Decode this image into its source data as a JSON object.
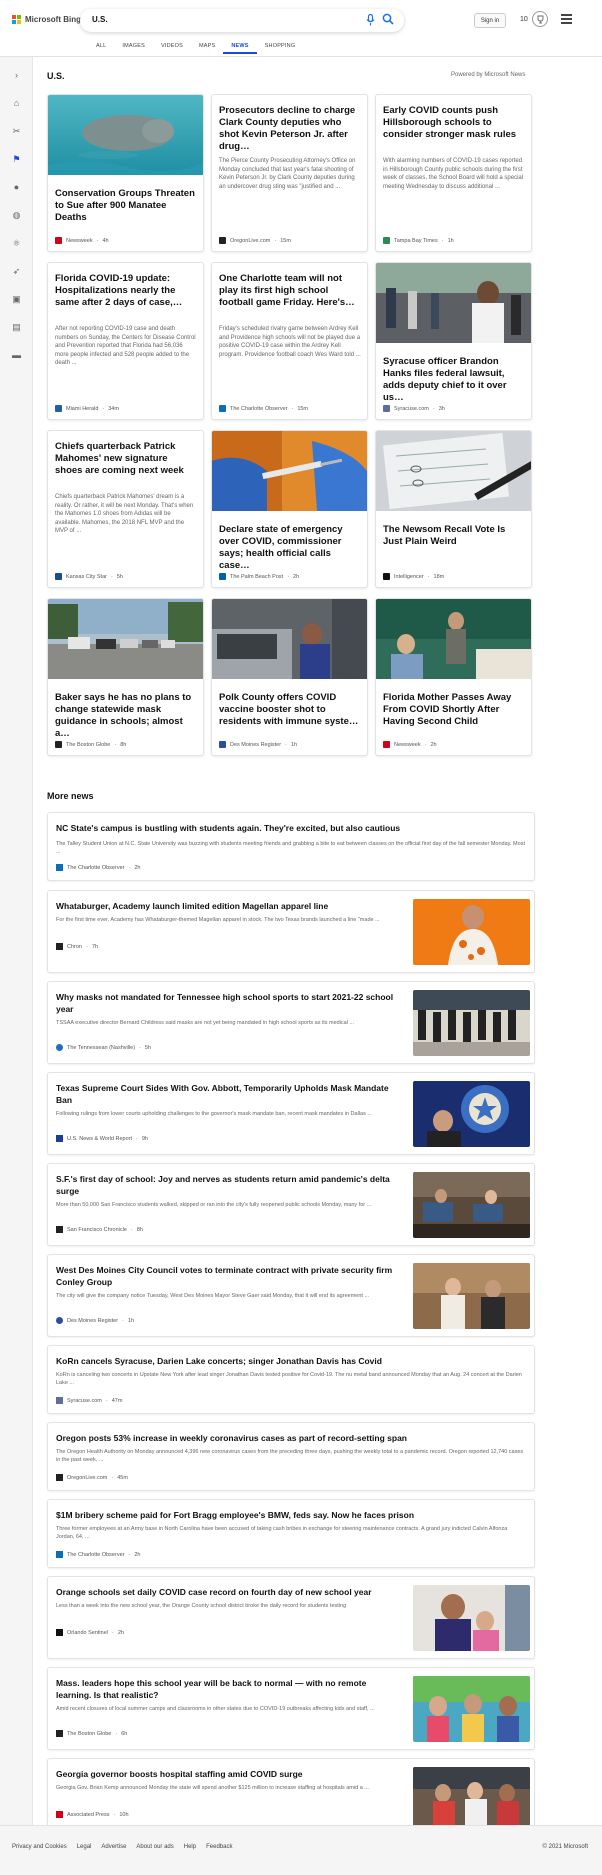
{
  "brand": {
    "name": "Microsoft Bing",
    "colors": [
      "#f25022",
      "#7fba00",
      "#00a4ef",
      "#ffb900"
    ]
  },
  "search": {
    "query": "U.S."
  },
  "header": {
    "sign_in": "Sign in",
    "rewards_points": "10"
  },
  "tabs": [
    {
      "label": "ALL"
    },
    {
      "label": "IMAGES"
    },
    {
      "label": "VIDEOS"
    },
    {
      "label": "MAPS"
    },
    {
      "label": "NEWS"
    },
    {
      "label": "SHOPPING"
    }
  ],
  "section": {
    "title": "U.S.",
    "powered_by": "Powered by Microsoft News"
  },
  "cards": [
    {
      "title": "Conservation Groups Threaten to Sue after 900 Manatee Deaths",
      "snippet": "",
      "source": "Newsweek",
      "age": "4h",
      "favicon": "#d0021b"
    },
    {
      "title": "Prosecutors decline to charge Clark County deputies who shot Kevin Peterson Jr. after drug…",
      "snippet": "The Pierce County Prosecuting Attorney's Office on Monday concluded that last year's fatal shooting of Kevin Peterson Jr. by Clark County deputies during an undercover drug sting was \"justified and ...",
      "source": "OregonLive.com",
      "age": "15m",
      "favicon": "#222222"
    },
    {
      "title": "Early COVID counts push Hillsborough schools to consider stronger mask rules",
      "snippet": "With alarming numbers of COVID-19 cases reported in Hillsborough County public schools during the first week of classes, the School Board will hold a special meeting Wednesday to discuss additional ...",
      "source": "Tampa Bay Times",
      "age": "1h",
      "favicon": "#2e8b57"
    },
    {
      "title": "Florida COVID-19 update: Hospitalizations nearly the same after 2 days of case,…",
      "snippet": "After not reporting COVID-19 case and death numbers on Sunday, the Centers for Disease Control and Prevention reported that Florida had 56,036 more people infected and 528 people added to the death ...",
      "source": "Miami Herald",
      "age": "34m",
      "favicon": "#1f5fa8"
    },
    {
      "title": "One Charlotte team will not play its first high school football game Friday. Here's…",
      "snippet": "Friday's scheduled rivalry game between Ardrey Kell and Providence high schools will not be played due a positive COVID-19 case within the Ardrey Kell program. Providence football coach Wes Ward told ...",
      "source": "The Charlotte Observer",
      "age": "15m",
      "favicon": "#0b6fb8"
    },
    {
      "title": "Syracuse officer Brandon Hanks files federal lawsuit, adds deputy chief to it over us…",
      "snippet": "",
      "source": "Syracuse.com",
      "age": "3h",
      "favicon": "#5b6f9a"
    },
    {
      "title": "Chiefs quarterback Patrick Mahomes' new signature shoes are coming next week",
      "snippet": "Chiefs quarterback Patrick Mahomes' dream is a reality. Or rather, it will be next Monday. That's when the Mahomes 1.0 shoes from Adidas will be available. Mahomes, the 2018 NFL MVP and the MVP of ...",
      "source": "Kansas City Star",
      "age": "5h",
      "favicon": "#1a4d8f"
    },
    {
      "title": "Declare state of emergency over COVID, commissioner says; health official calls case…",
      "snippet": "",
      "source": "The Palm Beach Post",
      "age": "2h",
      "favicon": "#0061a8"
    },
    {
      "title": "The Newsom Recall Vote Is Just Plain Weird",
      "snippet": "",
      "source": "Intelligencer",
      "age": "18m",
      "favicon": "#111111"
    },
    {
      "title": "Baker says he has no plans to change statewide mask guidance in schools; almost a…",
      "snippet": "",
      "source": "The Boston Globe",
      "age": "8h",
      "favicon": "#222222"
    },
    {
      "title": "Polk County offers COVID vaccine booster shot to residents with immune syste…",
      "snippet": "",
      "source": "Des Moines Register",
      "age": "1h",
      "favicon": "#2a4f9e"
    },
    {
      "title": "Florida Mother Passes Away From COVID Shortly After Having Second Child",
      "snippet": "",
      "source": "Newsweek",
      "age": "2h",
      "favicon": "#d0021b"
    }
  ],
  "more_news": {
    "title": "More news",
    "items": [
      {
        "title": "NC State's campus is bustling with students again. They're excited, but also cautious",
        "snippet": "The Talley Student Union at N.C. State University was buzzing with students meeting friends and grabbing a bite to eat between classes on the official first day of the fall semester Monday. Most ...",
        "source": "The Charlotte Observer",
        "age": "2h",
        "favicon": "#0b6fb8"
      },
      {
        "title": "Whataburger, Academy launch limited edition Magellan apparel line",
        "snippet": "For the first time ever, Academy has Whataburger-themed Magellan apparel in stock. The two Texas brands launched a line \"made ...",
        "source": "Chron",
        "age": "7h",
        "favicon": "#222222"
      },
      {
        "title": "Why masks not mandated for Tennessee high school sports to start 2021-22 school year",
        "snippet": "TSSAA executive director Bernard Childress said masks are not yet being mandated in high school sports as its medical ...",
        "source": "The Tennessean (Nashville)",
        "age": "5h",
        "favicon": "#1d6fc1"
      },
      {
        "title": "Texas Supreme Court Sides With Gov. Abbott, Temporarily Upholds Mask Mandate Ban",
        "snippet": "Following rulings from lower courts upholding challenges to the governor's mask mandate ban, recent mask mandates in Dallas ...",
        "source": "U.S. News & World Report",
        "age": "9h",
        "favicon": "#1c3f94"
      },
      {
        "title": "S.F.'s first day of school: Joy and nerves as students return amid pandemic's delta surge",
        "snippet": "More than 50,000 San Francisco students walked, skipped or ran into the city's fully reopened public schools Monday, many for ...",
        "source": "San Francisco Chronicle",
        "age": "8h",
        "favicon": "#222222"
      },
      {
        "title": "West Des Moines City Council votes to terminate contract with private security firm Conley Group",
        "snippet": "The city will give the company notice Tuesday, West Des Moines Mayor Steve Gaer said Monday, that it will end its agreement ...",
        "source": "Des Moines Register",
        "age": "1h",
        "favicon": "#2a4f9e"
      },
      {
        "title": "KoRn cancels Syracuse, Darien Lake concerts; singer Jonathan Davis has Covid",
        "snippet": "KoRn is canceling two concerts in Upstate New York after lead singer Jonathan Davis tested positive for Covid-19. The nu metal band announced Monday that an Aug. 24 concert at the Darien Lake ...",
        "source": "Syracuse.com",
        "age": "47m",
        "favicon": "#5b6f9a"
      },
      {
        "title": "Oregon posts 53% increase in weekly coronavirus cases as part of record-setting span",
        "snippet": "The Oregon Health Authority on Monday announced 4,396 new coronavirus cases from the preceding three days, pushing the weekly total to a pandemic record. Oregon reported 12,740 cases in the past week, ...",
        "source": "OregonLive.com",
        "age": "45m",
        "favicon": "#222222"
      },
      {
        "title": "$1M bribery scheme paid for Fort Bragg employee's BMW, feds say. Now he faces prison",
        "snippet": "Three former employees at an Army base in North Carolina have been accused of taking cash bribes in exchange for steering maintenance contracts. A grand jury indicted Calvin Alfonza Jordan, 64, ...",
        "source": "The Charlotte Observer",
        "age": "2h",
        "favicon": "#0b6fb8"
      },
      {
        "title": "Orange schools set daily COVID case record on fourth day of new school year",
        "snippet": "Less than a week into the new school year, the Orange County school district broke the daily record for students testing",
        "source": "Orlando Sentinel",
        "age": "2h",
        "favicon": "#111111"
      },
      {
        "title": "Mass. leaders hope this school year will be back to normal — with no remote learning. Is that realistic?",
        "snippet": "Amid recent closures of local summer camps and classrooms in other states due to COVID-19 outbreaks affecting kids and staff, ...",
        "source": "The Boston Globe",
        "age": "6h",
        "favicon": "#222222"
      },
      {
        "title": "Georgia governor boosts hospital staffing amid COVID surge",
        "snippet": "Georgia Gov. Brian Kemp announced Monday the state will spend another $125 million to increase staffing at hospitals amid a ...",
        "source": "Associated Press",
        "age": "10h",
        "favicon": "#d0021b"
      }
    ]
  },
  "footer": {
    "links": [
      "Privacy and Cookies",
      "Legal",
      "Advertise",
      "About our ads",
      "Help",
      "Feedback"
    ],
    "copyright": "© 2021 Microsoft"
  }
}
